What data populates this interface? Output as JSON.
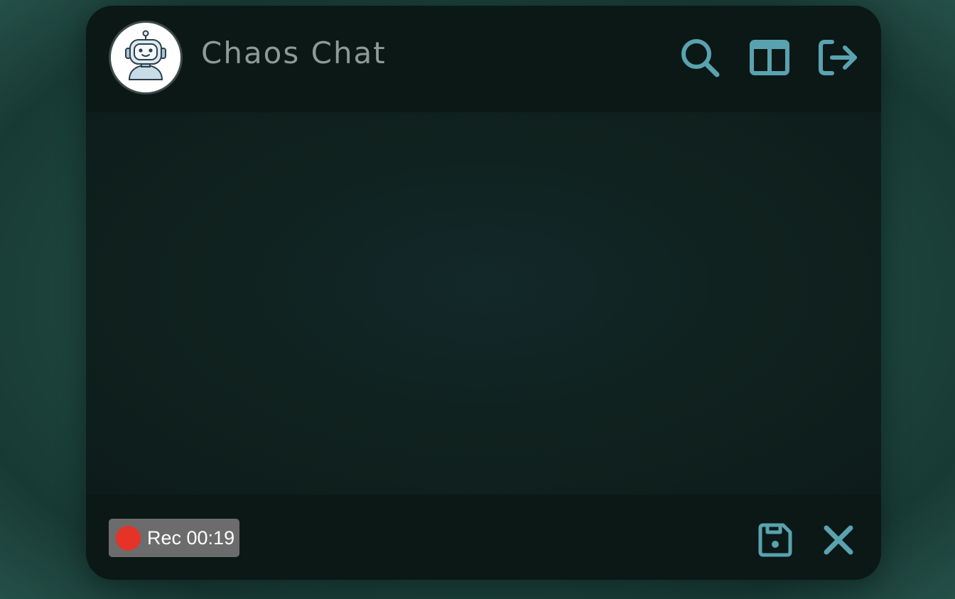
{
  "app": {
    "title": "Chaos Chat",
    "avatar_icon": "robot-icon"
  },
  "header": {
    "actions": [
      {
        "icon": "search-icon"
      },
      {
        "icon": "split-layout-icon"
      },
      {
        "icon": "logout-icon"
      }
    ]
  },
  "recording": {
    "label": "Rec 00:19",
    "dot_color": "#e63327"
  },
  "footer": {
    "actions": [
      {
        "icon": "save-icon"
      },
      {
        "icon": "close-icon"
      }
    ]
  },
  "colors": {
    "accent": "#5aa2b0",
    "title_text": "#8d9b98",
    "window_bg": "#0d1b1a"
  }
}
